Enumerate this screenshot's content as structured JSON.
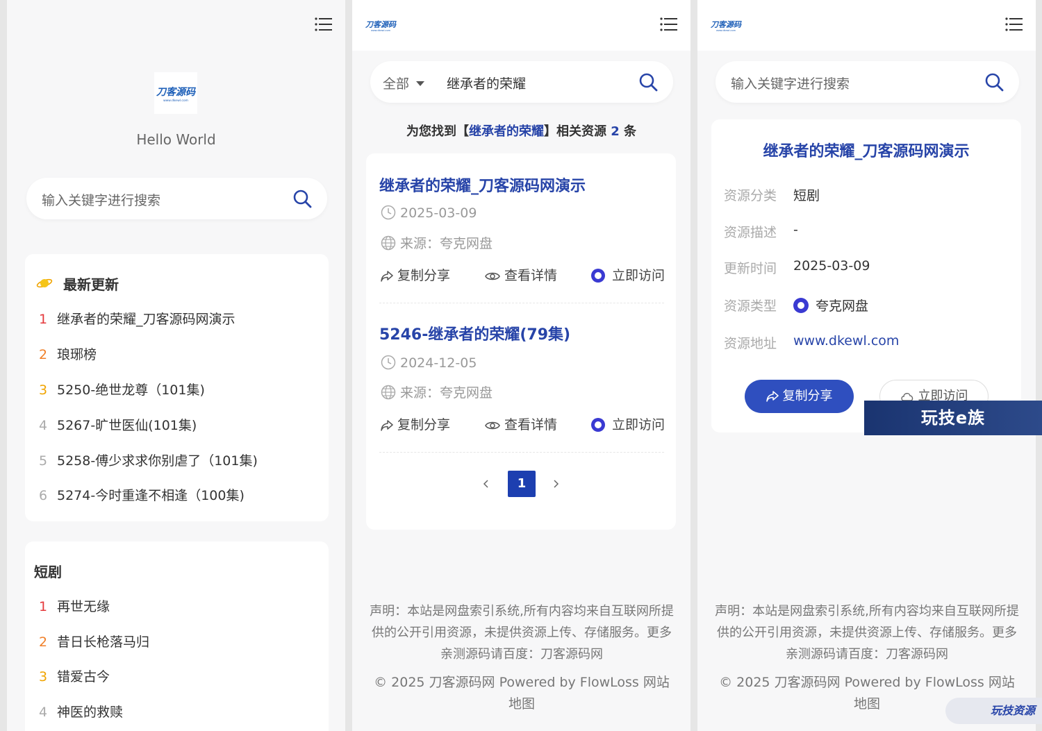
{
  "colors": {
    "accent": "#2744a8",
    "button": "#2f4fbf",
    "quark": "#3a3ad2"
  },
  "site": {
    "logo_text": "刀客源码",
    "logo_sub": "www.dkewl.com"
  },
  "left_panel": {
    "tagline": "Hello World",
    "search_placeholder": "输入关键字进行搜索",
    "latest": {
      "title": "最新更新",
      "items": [
        {
          "num": "1",
          "text": "继承者的荣耀_刀客源码网演示"
        },
        {
          "num": "2",
          "text": "琅琊榜"
        },
        {
          "num": "3",
          "text": "5250-绝世龙尊（101集)"
        },
        {
          "num": "4",
          "text": "5267-旷世医仙(101集)"
        },
        {
          "num": "5",
          "text": "5258-傅少求求你别虐了（101集)"
        },
        {
          "num": "6",
          "text": "5274-今时重逢不相逢（100集)"
        }
      ]
    },
    "category": {
      "title": "短剧",
      "items": [
        {
          "num": "1",
          "text": "再世无缘"
        },
        {
          "num": "2",
          "text": "昔日长枪落马归"
        },
        {
          "num": "3",
          "text": "错爱古今"
        },
        {
          "num": "4",
          "text": "神医的救赎"
        }
      ]
    }
  },
  "middle_panel": {
    "scope": "全部",
    "query": "继承者的荣耀",
    "summary": {
      "prefix": "为您找到【",
      "keyword": "继承者的荣耀",
      "mid": "】相关资源 ",
      "count": "2",
      "suffix": " 条"
    },
    "results": [
      {
        "title": "继承者的荣耀_刀客源码网演示",
        "date": "2025-03-09",
        "source": "来源：夸克网盘"
      },
      {
        "title": "5246-继承者的荣耀(79集)",
        "date": "2024-12-05",
        "source": "来源：夸克网盘"
      }
    ],
    "actions": {
      "share": "复制分享",
      "detail": "查看详情",
      "visit": "立即访问"
    },
    "page": "1"
  },
  "right_panel": {
    "search_placeholder": "输入关键字进行搜索",
    "detail": {
      "title": "继承者的荣耀_刀客源码网演示",
      "rows": [
        {
          "label": "资源分类",
          "value": "短剧"
        },
        {
          "label": "资源描述",
          "value": "-"
        },
        {
          "label": "更新时间",
          "value": "2025-03-09"
        },
        {
          "label": "资源类型",
          "value": "夸克网盘"
        },
        {
          "label": "资源地址",
          "value": "www.dkewl.com"
        }
      ],
      "share_button": "复制分享",
      "visit_button": "立即访问"
    }
  },
  "footer": {
    "disclaimer": "声明：本站是网盘索引系统,所有内容均来自互联网所提供的公开引用资源，未提供资源上传、存储服务。更多亲测源码请百度：刀客源码网",
    "copyright": "© 2025 刀客源码网 Powered by FlowLoss 网站地图"
  },
  "watermarks": {
    "center": "玩技e族",
    "corner": "玩技资源"
  }
}
